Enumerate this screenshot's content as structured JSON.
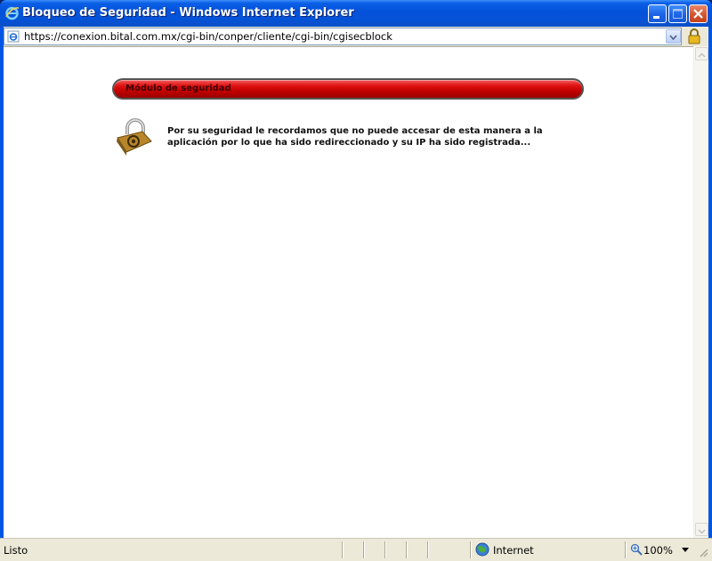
{
  "window": {
    "title": "Bloqueo de Seguridad - Windows Internet Explorer",
    "icon": "ie-icon",
    "buttons": [
      "minimize-icon",
      "maximize-icon",
      "close-icon"
    ]
  },
  "address_bar": {
    "url": "https://conexion.bital.com.mx/cgi-bin/conper/cliente/cgi-bin/cgisecblock",
    "page_icon": "ie-page-icon",
    "security_icon": "lock-icon"
  },
  "page": {
    "banner_title": "Módulo de seguridad",
    "banner_color": "#d40000",
    "icon": "padlock-icon",
    "message": "Por su seguridad le recordamos que no puede accesar de esta manera a la aplicación por lo que ha sido redireccionado y su IP ha sido registrada..."
  },
  "status_bar": {
    "status": "Listo",
    "zone": "Internet",
    "zone_icon": "globe-icon",
    "zoom": "100%"
  }
}
